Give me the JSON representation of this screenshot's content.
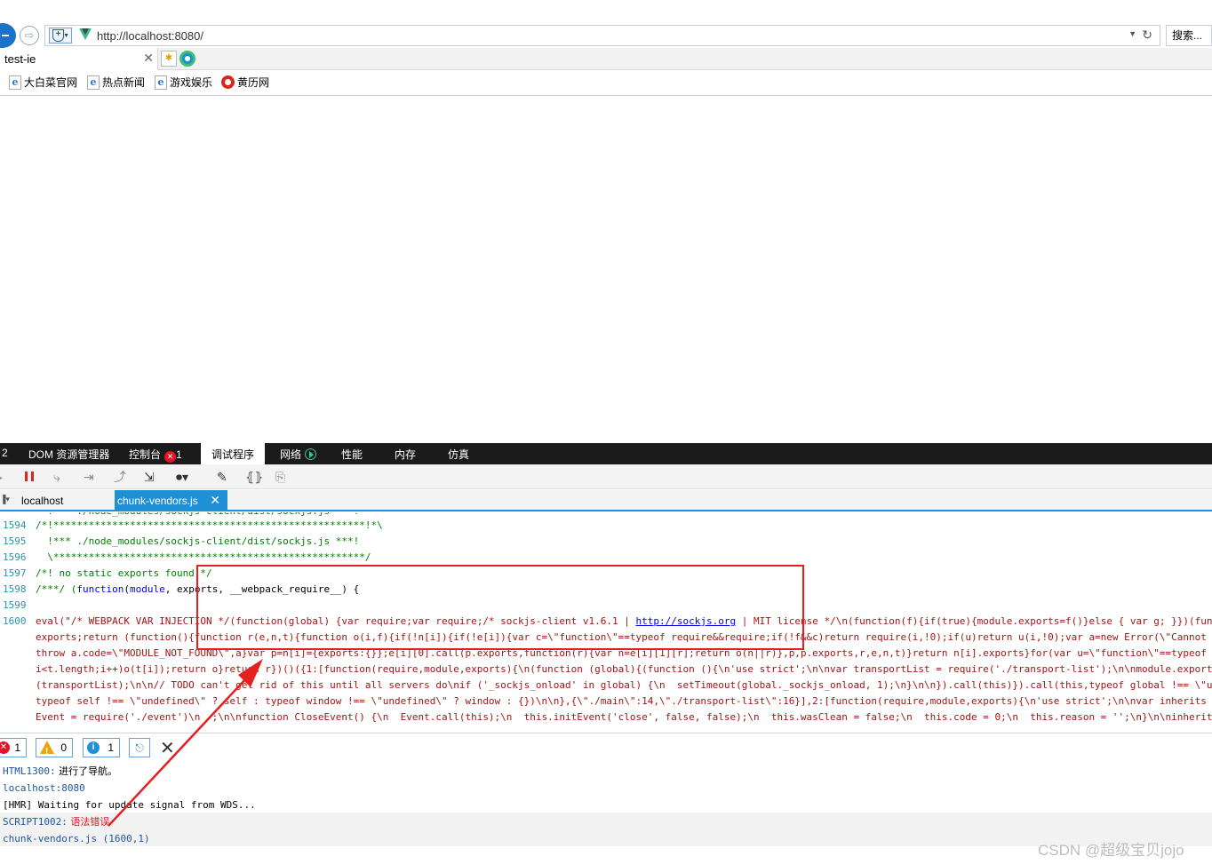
{
  "browser": {
    "url": "http://localhost:8080/",
    "search_label": "搜索...",
    "tab_title": "test-ie",
    "favorites": [
      {
        "label": "大白菜官网",
        "icon": "ie-page-icon"
      },
      {
        "label": "热点新闻",
        "icon": "ie-page-icon"
      },
      {
        "label": "游戏娱乐",
        "icon": "ie-page-icon"
      },
      {
        "label": "黄历网",
        "icon": "huangli-icon"
      }
    ]
  },
  "devtools": {
    "tab_index": "2",
    "tabs": {
      "dom": "DOM 资源管理器",
      "console": "控制台",
      "console_errors": "1",
      "debugger": "调试程序",
      "network": "网络",
      "performance": "性能",
      "memory": "内存",
      "emulation": "仿真"
    },
    "file_tabs": {
      "localhost": "localhost",
      "active_file": "chunk-vendors.js"
    },
    "code_lines": [
      {
        "n": "1594",
        "a": "/*!*****************************************************!*\\"
      },
      {
        "n": "1595",
        "a": "  !*** ./node_modules/sockjs-client/dist/sockjs.js ***!"
      },
      {
        "n": "1596",
        "a": "  \\*****************************************************/"
      },
      {
        "n": "1597",
        "a": "/*! no static exports found */"
      },
      {
        "n": "1598",
        "a": "/***/ (",
        "b": "function",
        "c": "(",
        "d": "module",
        "e": ", exports, __webpack_require__) {"
      },
      {
        "n": "1599",
        "a": ""
      },
      {
        "n": "1600",
        "a": "eval(\"/* WEBPACK VAR INJECTION */(function(global) {var require;var require;/* sockjs-client v1.6.1 | ",
        "link": "http://sockjs.org",
        "z": " | MIT license */\\n(function(f){if(true){module.exports=f()}else { var g; }})(func"
      }
    ],
    "code_wrap": [
      "exports;return (function(){function r(e,n,t){function o(i,f){if(!n[i]){if(!e[i]){var c=\\\"function\\\"==typeof require&&require;if(!f&&c)return require(i,!0);if(u)return u(i,!0);var a=new Error(\\\"Cannot",
      "throw a.code=\\\"MODULE_NOT_FOUND\\\",a}var p=n[i]={exports:{}};e[i][0].call(p.exports,function(r){var n=e[i][1][r];return o(n||r)},p,p.exports,r,e,n,t)}return n[i].exports}for(var u=\\\"function\\\"==typeof r",
      "i<t.length;i++)o(t[i]);return o}return r})()({1:[function(require,module,exports){\\n(function (global){(function (){\\n'use strict';\\n\\nvar transportList = require('./transport-list');\\n\\nmodule.exports",
      "(transportList);\\n\\n// TODO can't get rid of this until all servers do\\nif ('_sockjs_onload' in global) {\\n  setTimeout(global._sockjs_onload, 1);\\n}\\n\\n}).call(this)}).call(this,typeof global !== \\\"un",
      "typeof self !== \\\"undefined\\\" ? self : typeof window !== \\\"undefined\\\" ? window : {})\\n\\n},{\\\"./main\\\":14,\\\"./transport-list\\\":16}],2:[function(require,module,exports){\\n'use strict';\\n\\nvar inherits =",
      "Event = require('./event')\\n  ;\\n\\nfunction CloseEvent() {\\n  Event.call(this);\\n  this.initEvent('close', false, false);\\n  this.wasClean = false;\\n  this.code = 0;\\n  this.reason = '';\\n}\\n\\ninherits"
    ],
    "console_counts": {
      "errors": "1",
      "warnings": "0",
      "info": "1"
    },
    "console_messages": [
      {
        "code": "HTML1300:",
        "text": " 进行了导航。"
      },
      {
        "code": "localhost:8080",
        "text": ""
      },
      {
        "code": "",
        "text": "[HMR] Waiting for update signal from WDS..."
      },
      {
        "code": "SCRIPT1002:",
        "text": " 语法错误"
      },
      {
        "code": "chunk-vendors.js (1600,1)",
        "text": ""
      }
    ]
  },
  "watermark": "CSDN @超级宝贝jojo",
  "colors": {
    "accent": "#1f8fd6",
    "error": "#e81123",
    "annotation": "#e62020"
  }
}
